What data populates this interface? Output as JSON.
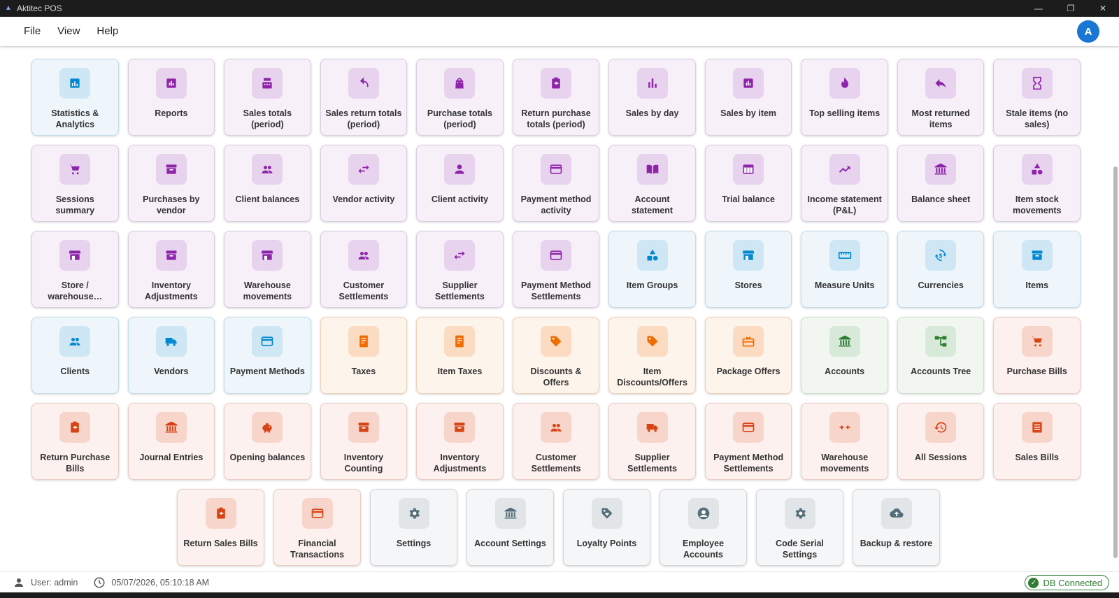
{
  "window": {
    "title": "Aktitec POS"
  },
  "menu": {
    "file": "File",
    "view": "View",
    "help": "Help",
    "avatar_letter": "A"
  },
  "tiles": [
    [
      {
        "label": "Statistics & Analytics",
        "theme": "blue",
        "icon": "analytics-icon"
      },
      {
        "label": "Reports",
        "theme": "purple",
        "icon": "report-icon"
      },
      {
        "label": "Sales totals (period)",
        "theme": "purple",
        "icon": "cash-register-icon"
      },
      {
        "label": "Sales return totals (period)",
        "theme": "purple",
        "icon": "undo-icon"
      },
      {
        "label": "Purchase totals (period)",
        "theme": "purple",
        "icon": "shopping-bag-icon"
      },
      {
        "label": "Return purchase totals (period)",
        "theme": "purple",
        "icon": "clipboard-return-icon"
      },
      {
        "label": "Sales by day",
        "theme": "purple",
        "icon": "bar-chart-icon"
      },
      {
        "label": "Sales by item",
        "theme": "purple",
        "icon": "report-icon"
      },
      {
        "label": "Top selling items",
        "theme": "purple",
        "icon": "flame-icon"
      },
      {
        "label": "Most returned items",
        "theme": "purple",
        "icon": "reply-icon"
      },
      {
        "label": "Stale items (no sales)",
        "theme": "purple",
        "icon": "hourglass-icon"
      }
    ],
    [
      {
        "label": "Sessions summary",
        "theme": "purple",
        "icon": "cart-icon"
      },
      {
        "label": "Purchases by vendor",
        "theme": "purple",
        "icon": "archive-icon"
      },
      {
        "label": "Client balances",
        "theme": "purple",
        "icon": "people-icon"
      },
      {
        "label": "Vendor activity",
        "theme": "purple",
        "icon": "swap-icon"
      },
      {
        "label": "Client activity",
        "theme": "purple",
        "icon": "person-icon"
      },
      {
        "label": "Payment method activity",
        "theme": "purple",
        "icon": "credit-card-icon"
      },
      {
        "label": "Account statement",
        "theme": "purple",
        "icon": "book-icon"
      },
      {
        "label": "Trial balance",
        "theme": "purple",
        "icon": "table-icon"
      },
      {
        "label": "Income statement (P&L)",
        "theme": "purple",
        "icon": "trending-up-icon"
      },
      {
        "label": "Balance sheet",
        "theme": "purple",
        "icon": "bank-icon"
      },
      {
        "label": "Item stock movements",
        "theme": "purple",
        "icon": "shapes-icon"
      }
    ],
    [
      {
        "label": "Store / warehouse…",
        "theme": "purple",
        "icon": "store-icon"
      },
      {
        "label": "Inventory Adjustments",
        "theme": "purple",
        "icon": "archive-icon"
      },
      {
        "label": "Warehouse movements",
        "theme": "purple",
        "icon": "store-icon"
      },
      {
        "label": "Customer Settlements",
        "theme": "purple",
        "icon": "people-icon"
      },
      {
        "label": "Supplier Settlements",
        "theme": "purple",
        "icon": "swap-icon"
      },
      {
        "label": "Payment Method Settlements",
        "theme": "purple",
        "icon": "credit-card-icon"
      },
      {
        "label": "Item Groups",
        "theme": "blue",
        "icon": "shapes-icon"
      },
      {
        "label": "Stores",
        "theme": "blue",
        "icon": "store-icon"
      },
      {
        "label": "Measure Units",
        "theme": "blue",
        "icon": "ruler-icon"
      },
      {
        "label": "Currencies",
        "theme": "blue",
        "icon": "currency-exchange-icon"
      },
      {
        "label": "Items",
        "theme": "blue",
        "icon": "archive-icon"
      }
    ],
    [
      {
        "label": "Clients",
        "theme": "blue",
        "icon": "people-icon"
      },
      {
        "label": "Vendors",
        "theme": "blue",
        "icon": "truck-icon"
      },
      {
        "label": "Payment Methods",
        "theme": "blue",
        "icon": "credit-card-icon"
      },
      {
        "label": "Taxes",
        "theme": "orange",
        "icon": "receipt-icon"
      },
      {
        "label": "Item Taxes",
        "theme": "orange",
        "icon": "receipt-icon"
      },
      {
        "label": "Discounts & Offers",
        "theme": "orange",
        "icon": "tag-icon"
      },
      {
        "label": "Item Discounts/Offers",
        "theme": "orange",
        "icon": "tag-icon"
      },
      {
        "label": "Package Offers",
        "theme": "orange",
        "icon": "gift-card-icon"
      },
      {
        "label": "Accounts",
        "theme": "green",
        "icon": "bank-icon"
      },
      {
        "label": "Accounts Tree",
        "theme": "green",
        "icon": "tree-icon"
      },
      {
        "label": "Purchase Bills",
        "theme": "red",
        "icon": "cart-icon"
      }
    ],
    [
      {
        "label": "Return Purchase Bills",
        "theme": "red",
        "icon": "clipboard-return-icon"
      },
      {
        "label": "Journal Entries",
        "theme": "red",
        "icon": "bank-icon"
      },
      {
        "label": "Opening balances",
        "theme": "red",
        "icon": "piggy-bank-icon"
      },
      {
        "label": "Inventory Counting",
        "theme": "red",
        "icon": "archive-icon"
      },
      {
        "label": "Inventory Adjustments",
        "theme": "red",
        "icon": "archive-icon"
      },
      {
        "label": "Customer Settlements",
        "theme": "red",
        "icon": "people-icon"
      },
      {
        "label": "Supplier Settlements",
        "theme": "red",
        "icon": "truck-icon"
      },
      {
        "label": "Payment Method Settlements",
        "theme": "red",
        "icon": "credit-card-icon"
      },
      {
        "label": "Warehouse movements",
        "theme": "red",
        "icon": "compare-arrows-icon"
      },
      {
        "label": "All Sessions",
        "theme": "red",
        "icon": "history-icon"
      },
      {
        "label": "Sales Bills",
        "theme": "red",
        "icon": "list-doc-icon"
      }
    ],
    [
      {
        "label": "Return Sales Bills",
        "theme": "red",
        "icon": "clipboard-return-icon"
      },
      {
        "label": "Financial Transactions",
        "theme": "red",
        "icon": "credit-card-icon"
      },
      {
        "label": "Settings",
        "theme": "grey",
        "icon": "gear-icon"
      },
      {
        "label": "Account Settings",
        "theme": "grey",
        "icon": "bank-icon"
      },
      {
        "label": "Loyalty Points",
        "theme": "grey",
        "icon": "loyalty-icon"
      },
      {
        "label": "Employee Accounts",
        "theme": "grey",
        "icon": "account-circle-icon"
      },
      {
        "label": "Code Serial Settings",
        "theme": "grey",
        "icon": "gear-icon"
      },
      {
        "label": "Backup & restore",
        "theme": "grey",
        "icon": "cloud-upload-icon"
      }
    ]
  ],
  "status": {
    "user": "User: admin",
    "datetime": "05/07/2026, 05:10:18 AM",
    "db": "DB Connected"
  }
}
